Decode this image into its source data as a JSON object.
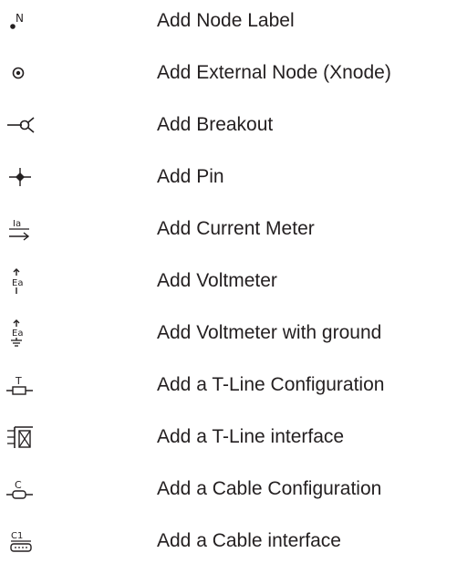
{
  "items": [
    {
      "icon": "node-label-icon",
      "label": "Add Node Label"
    },
    {
      "icon": "external-node-icon",
      "label": "Add External Node (Xnode)"
    },
    {
      "icon": "breakout-icon",
      "label": "Add Breakout"
    },
    {
      "icon": "pin-icon",
      "label": "Add Pin"
    },
    {
      "icon": "current-meter-icon",
      "label": "Add Current Meter"
    },
    {
      "icon": "voltmeter-icon",
      "label": "Add Voltmeter"
    },
    {
      "icon": "voltmeter-ground-icon",
      "label": "Add Voltmeter with ground"
    },
    {
      "icon": "tline-configuration-icon",
      "label": "Add a T-Line Configuration"
    },
    {
      "icon": "tline-interface-icon",
      "label": "Add a T-Line interface"
    },
    {
      "icon": "cable-configuration-icon",
      "label": "Add a Cable Configuration"
    },
    {
      "icon": "cable-interface-icon",
      "label": "Add a Cable interface"
    }
  ],
  "icon_text": {
    "node_label": "N",
    "current": "Ia",
    "voltage": "Ea",
    "tline": "T",
    "cable": "C",
    "cable_interface": "C1"
  }
}
